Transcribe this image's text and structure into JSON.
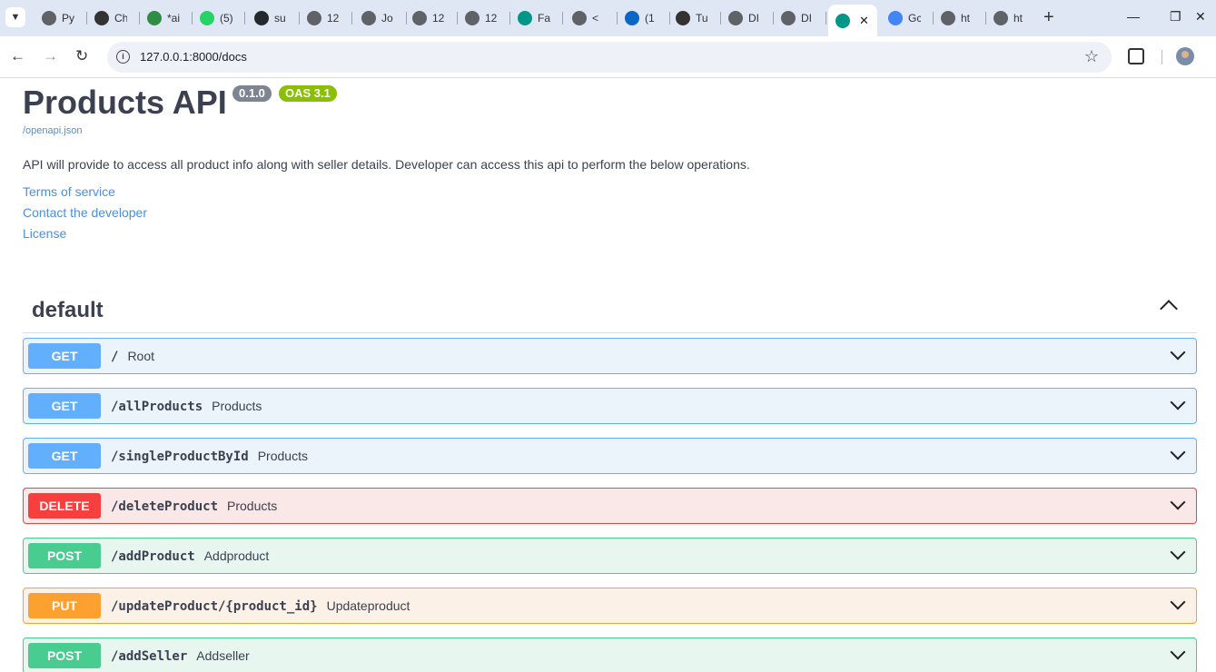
{
  "browser": {
    "tabs": [
      {
        "label": "Py",
        "icon": "globe-icon",
        "color": "#5f6368"
      },
      {
        "label": "Ch",
        "icon": "chatgpt-icon",
        "color": "#333333"
      },
      {
        "label": "*ai",
        "icon": "gfg-icon",
        "color": "#2f8d46"
      },
      {
        "label": "(5)",
        "icon": "whatsapp-icon",
        "color": "#25d366"
      },
      {
        "label": "su",
        "icon": "github-icon",
        "color": "#24292e"
      },
      {
        "label": "12",
        "icon": "globe-icon",
        "color": "#5f6368"
      },
      {
        "label": "Jo",
        "icon": "globe-icon",
        "color": "#5f6368"
      },
      {
        "label": "12",
        "icon": "globe-icon",
        "color": "#5f6368"
      },
      {
        "label": "12",
        "icon": "globe-icon",
        "color": "#5f6368"
      },
      {
        "label": "Fa",
        "icon": "fastapi-icon",
        "color": "#009688"
      },
      {
        "label": "<",
        "icon": "globe-icon",
        "color": "#5f6368"
      },
      {
        "label": "(1",
        "icon": "linkedin-icon",
        "color": "#0a66c2"
      },
      {
        "label": "Tu",
        "icon": "globe-icon",
        "color": "#333333"
      },
      {
        "label": "DI",
        "icon": "globe-icon",
        "color": "#5f6368"
      },
      {
        "label": "DI",
        "icon": "globe-icon",
        "color": "#5f6368"
      }
    ],
    "active_tab": {
      "icon": "fastapi-icon",
      "color": "#009688"
    },
    "after_tabs": [
      {
        "label": "Gc",
        "icon": "google-icon",
        "color": "#4285f4"
      },
      {
        "label": "ht",
        "icon": "globe-icon",
        "color": "#5f6368"
      },
      {
        "label": "ht",
        "icon": "globe-icon",
        "color": "#5f6368"
      }
    ],
    "url": "127.0.0.1:8000/docs"
  },
  "api": {
    "title": "Products API",
    "version": "0.1.0",
    "oas": "OAS 3.1",
    "openapi_link": "/openapi.json",
    "description": "API will provide to access all product info along with seller details. Developer can access this api to perform the below operations.",
    "links": [
      "Terms of service",
      "Contact the developer",
      "License"
    ]
  },
  "section": {
    "name": "default"
  },
  "operations": [
    {
      "method": "GET",
      "path": "/",
      "summary": "Root",
      "kind": "get"
    },
    {
      "method": "GET",
      "path": "/allProducts",
      "summary": "Products",
      "kind": "get"
    },
    {
      "method": "GET",
      "path": "/singleProductById",
      "summary": "Products",
      "kind": "get"
    },
    {
      "method": "DELETE",
      "path": "/deleteProduct",
      "summary": "Products",
      "kind": "delete"
    },
    {
      "method": "POST",
      "path": "/addProduct",
      "summary": "Addproduct",
      "kind": "post"
    },
    {
      "method": "PUT",
      "path": "/updateProduct/{product_id}",
      "summary": "Updateproduct",
      "kind": "put"
    },
    {
      "method": "POST",
      "path": "/addSeller",
      "summary": "Addseller",
      "kind": "post"
    }
  ]
}
